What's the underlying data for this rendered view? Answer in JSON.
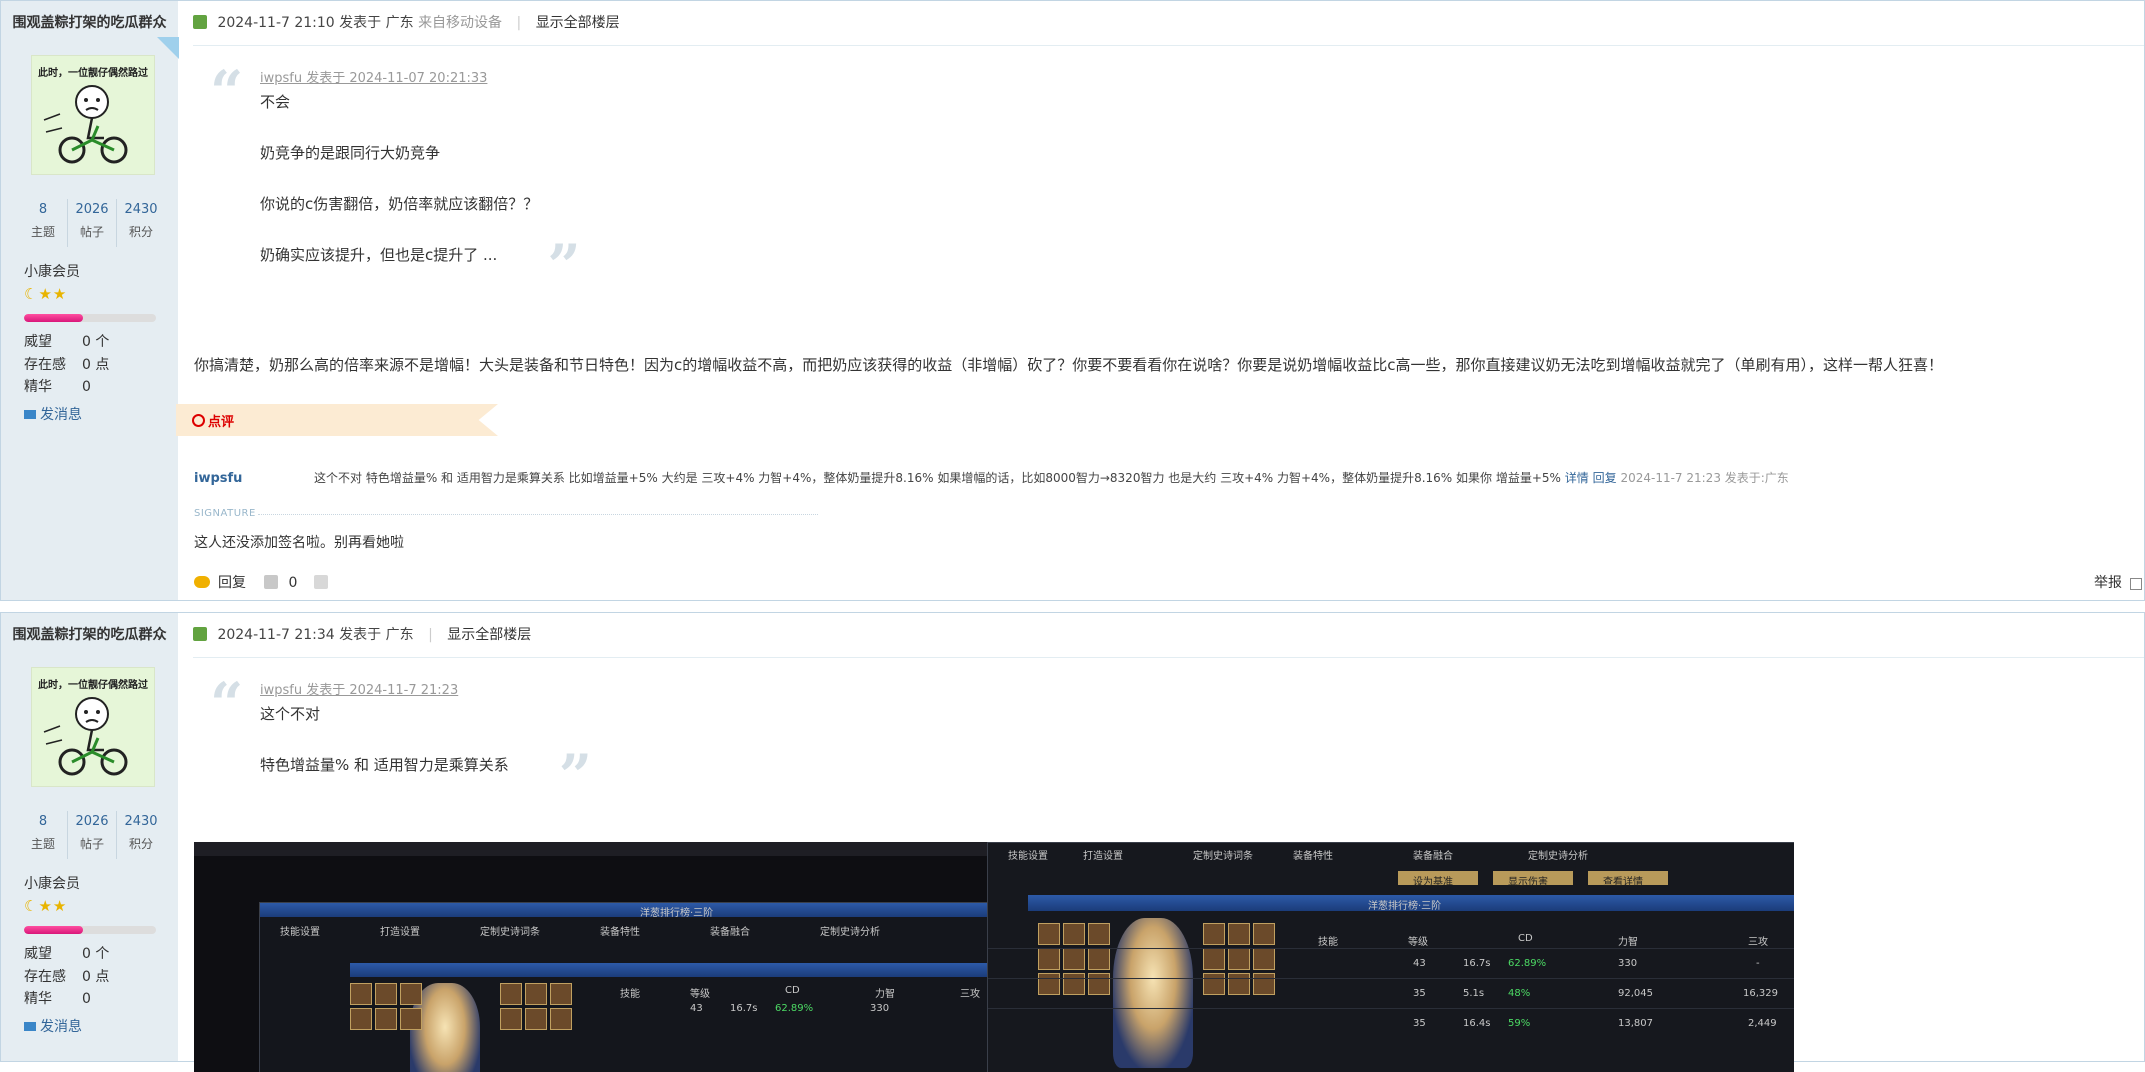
{
  "posts": [
    {
      "user": {
        "name": "围观盖粽打架的吃瓜群众",
        "avatar_caption": "此时，一位靓仔偶然路过",
        "stats": [
          {
            "value": "8",
            "label": "主题"
          },
          {
            "value": "2026",
            "label": "帖子"
          },
          {
            "value": "2430",
            "label": "积分"
          }
        ],
        "group": "小康会员",
        "level_progress_percent": 45,
        "fields": [
          {
            "key": "威望",
            "value": "0 个"
          },
          {
            "key": "存在感",
            "value": "0 点"
          },
          {
            "key": "精华",
            "value": "0"
          }
        ],
        "send_message": "发消息"
      },
      "header": {
        "datetime": "2024-11-7 21:10",
        "posted_in": "发表于 广东",
        "device": "来自移动设备",
        "sep": "|",
        "show_all": "显示全部楼层"
      },
      "quote": {
        "head": "iwpsfu 发表于 2024-11-07 20:21:33",
        "lines": [
          "不会",
          "奶竞争的是跟同行大奶竞争",
          "你说的c伤害翻倍，奶倍率就应该翻倍？？",
          "奶确实应该提升，但也是c提升了 ..."
        ]
      },
      "body": "你搞清楚，奶那么高的倍率来源不是增幅！大头是装备和节日特色！因为c的增幅收益不高，而把奶应该获得的收益（非增幅）砍了？你要不要看看你在说啥？你要是说奶增幅收益比c高一些，那你直接建议奶无法吃到增幅收益就完了（单刷有用），这样一帮人狂喜！",
      "dianping": {
        "label": "点评",
        "user": "iwpsfu",
        "text": "这个不对 特色增益量% 和 适用智力是乘算关系 比如增益量+5% 大约是 三攻+4% 力智+4%，整体奶量提升8.16% 如果增幅的话，比如8000智力→8320智力 也是大约 三攻+4% 力智+4%，整体奶量提升8.16% 如果你 增益量+5%",
        "detail": "详情",
        "reply": "回复",
        "date": "2024-11-7 21:23 发表于:广东"
      },
      "signature": {
        "label": "SIGNATURE",
        "text": "这人还没添加签名啦。别再看她啦"
      },
      "actions": {
        "reply": "回复",
        "likes": "0",
        "report": "举报"
      }
    },
    {
      "user": {
        "name": "围观盖粽打架的吃瓜群众",
        "avatar_caption": "此时，一位靓仔偶然路过",
        "stats": [
          {
            "value": "8",
            "label": "主题"
          },
          {
            "value": "2026",
            "label": "帖子"
          },
          {
            "value": "2430",
            "label": "积分"
          }
        ],
        "group": "小康会员",
        "level_progress_percent": 45,
        "fields": [
          {
            "key": "威望",
            "value": "0 个"
          },
          {
            "key": "存在感",
            "value": "0 点"
          },
          {
            "key": "精华",
            "value": "0"
          }
        ],
        "send_message": "发消息"
      },
      "header": {
        "datetime": "2024-11-7 21:34",
        "posted_in": "发表于 广东",
        "sep": "|",
        "show_all": "显示全部楼层"
      },
      "quote": {
        "head": "iwpsfu 发表于 2024-11-7 21:23",
        "lines": [
          "这个不对",
          "特色增益量% 和 适用智力是乘算关系"
        ]
      },
      "screenshot": {
        "header_left": "洋葱排行榜·三阶",
        "header_right": "洋葱排行榜·三阶",
        "tabs": [
          "技能设置",
          "打造设置",
          "定制史诗词条",
          "装备特性",
          "装备融合",
          "定制史诗分析"
        ],
        "buttons": [
          "设为基准",
          "显示伤害",
          "查看详情"
        ],
        "cols": [
          "技能",
          "等级",
          "CD",
          "力智",
          "三攻"
        ],
        "rows": [
          [
            "43",
            "16.7s",
            "62.89%",
            "330",
            "-"
          ],
          [
            "35",
            "5.1s",
            "48%",
            "92,045",
            "16,329"
          ],
          [
            "35",
            "16.4s",
            "59%",
            "13,807",
            "2,449"
          ]
        ]
      }
    }
  ],
  "colors": {
    "link": "#336699",
    "sidebar": "#e5edf2",
    "border": "#c2d5e3",
    "accent_red": "#dd0000"
  }
}
